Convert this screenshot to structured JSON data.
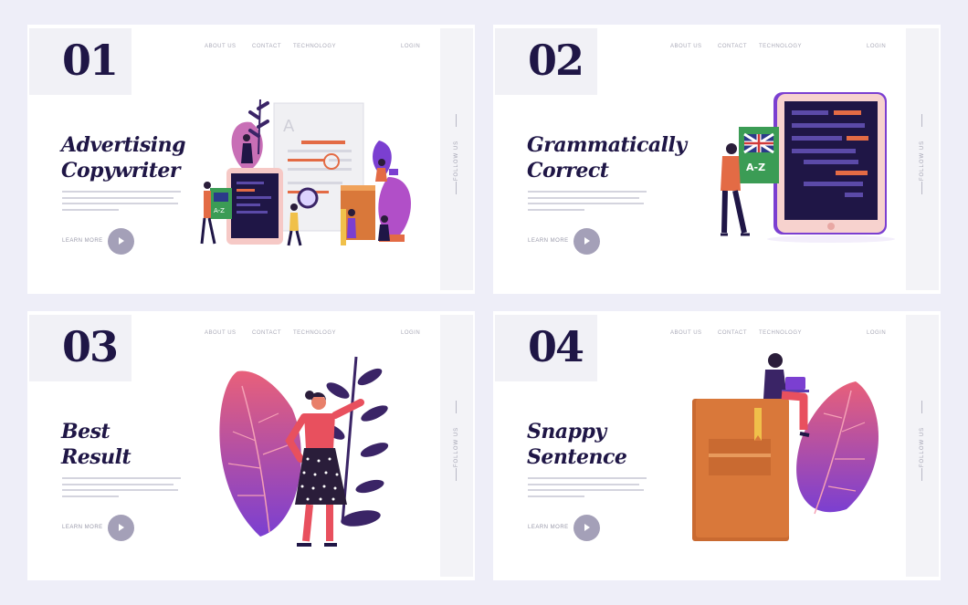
{
  "nav": {
    "about": "ABOUT US",
    "contact": "CONTACT",
    "technology": "TECHNOLOGY",
    "login": "LOGIN"
  },
  "follow_label": "FOLLOW US",
  "learn_label": "LEARN MORE",
  "cards": [
    {
      "number": "01",
      "title_line1": "Advertising",
      "title_line2": "Copywriter"
    },
    {
      "number": "02",
      "title_line1": "Grammatically",
      "title_line2": "Correct"
    },
    {
      "number": "03",
      "title_line1": "Best",
      "title_line2": "Result"
    },
    {
      "number": "04",
      "title_line1": "Snappy",
      "title_line2": "Sentence"
    }
  ],
  "illustration_text": {
    "dictionary_label": "A-Z",
    "doc_letter": "A"
  },
  "colors": {
    "page_bg": "#eeeef8",
    "heading": "#1f1646",
    "play_button": "#a4a0b8",
    "accent_orange": "#e36b45",
    "accent_purple": "#7b3fd1",
    "accent_pink": "#e8607a"
  }
}
